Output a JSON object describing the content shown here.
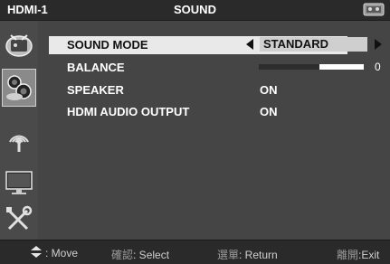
{
  "header": {
    "input_name": "HDMI-1",
    "menu_title": "SOUND",
    "tv_icon": "tv-status-icon"
  },
  "sidebar": {
    "items": [
      {
        "name": "picture",
        "icon": "picture-menu-icon"
      },
      {
        "name": "sound",
        "icon": "speaker-menu-icon",
        "active": true
      },
      {
        "name": "channel",
        "icon": "antenna-menu-icon"
      },
      {
        "name": "screen",
        "icon": "monitor-menu-icon"
      },
      {
        "name": "setup",
        "icon": "tools-menu-icon"
      }
    ]
  },
  "menu": {
    "sound_mode": {
      "label": "SOUND MODE",
      "value": "STANDARD"
    },
    "balance": {
      "label": "BALANCE",
      "value": "0",
      "level_percent": 58
    },
    "speaker": {
      "label": "SPEAKER",
      "value": "ON"
    },
    "hdmi_audio_output": {
      "label": "HDMI AUDIO OUTPUT",
      "value": "ON"
    }
  },
  "footer": {
    "move": ": Move",
    "select_key": "確認",
    "select": ": Select",
    "return_key": "選單",
    "return": ": Return",
    "exit_key": "離開",
    "exit": ":Exit"
  },
  "colors": {
    "background": "#3e3e3e",
    "selected_row": "#e9e9e9",
    "text": "#ffffff"
  }
}
